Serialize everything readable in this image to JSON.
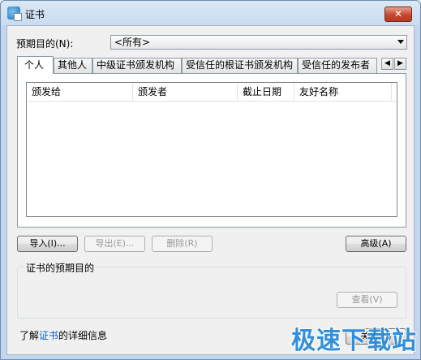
{
  "window": {
    "title": "证书",
    "close_label": "✕"
  },
  "purpose": {
    "label": "预期目的(N):",
    "selected": "<所有>"
  },
  "tabs": [
    {
      "label": "个人"
    },
    {
      "label": "其他人"
    },
    {
      "label": "中级证书颁发机构"
    },
    {
      "label": "受信任的根证书颁发机构"
    },
    {
      "label": "受信任的发布者"
    }
  ],
  "tab_scroll": {
    "left": "◀",
    "right": "▶"
  },
  "columns": [
    "颁发给",
    "颁发者",
    "截止日期",
    "友好名称"
  ],
  "buttons": {
    "import": "导入(I)...",
    "export": "导出(E)...",
    "remove": "删除(R)",
    "advanced": "高级(A)",
    "view": "查看(V)",
    "close": "关闭(C)"
  },
  "group": {
    "title": "证书的预期目的"
  },
  "footer": {
    "prefix": "了解",
    "link": "证书",
    "suffix": "的详细信息"
  },
  "watermark": "极速下载站"
}
